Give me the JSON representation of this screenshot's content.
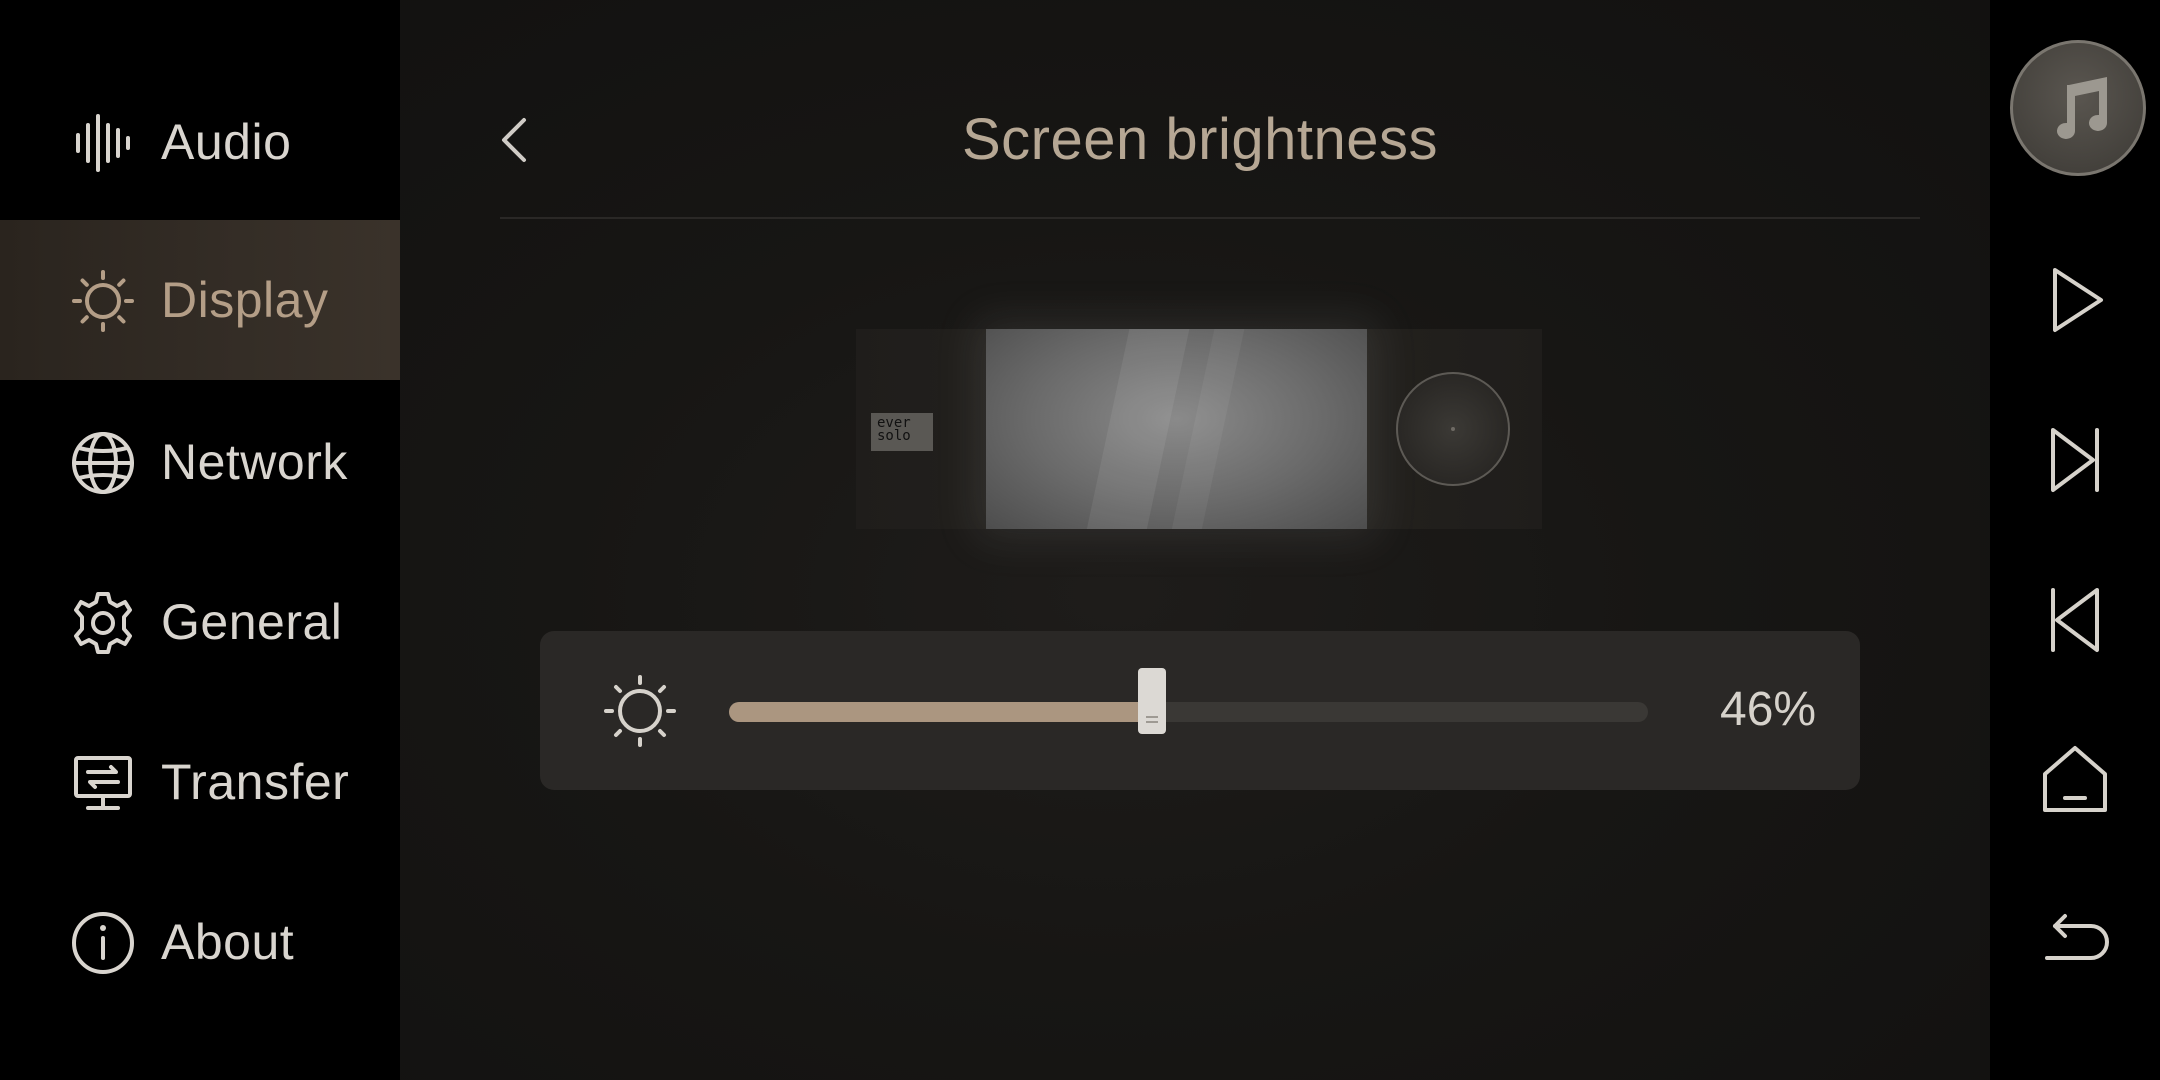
{
  "sidebar": {
    "items": [
      {
        "label": "Audio",
        "icon": "waveform-icon",
        "active": false
      },
      {
        "label": "Display",
        "icon": "brightness-icon",
        "active": true
      },
      {
        "label": "Network",
        "icon": "globe-icon",
        "active": false
      },
      {
        "label": "General",
        "icon": "gear-icon",
        "active": false
      },
      {
        "label": "Transfer",
        "icon": "transfer-icon",
        "active": false
      },
      {
        "label": "About",
        "icon": "info-icon",
        "active": false
      }
    ]
  },
  "header": {
    "title": "Screen brightness",
    "back_icon": "chevron-left-icon"
  },
  "preview": {
    "logo_text_1": "ever",
    "logo_text_2": "solo"
  },
  "brightness": {
    "value": 46,
    "value_label": "46%",
    "icon": "sun-icon"
  },
  "media_bar": {
    "album_icon": "music-note-icon",
    "buttons": [
      "play-icon",
      "skip-next-icon",
      "skip-previous-icon",
      "home-icon",
      "return-icon"
    ]
  },
  "colors": {
    "accent": "#b49e87",
    "slider_fill": "#ab9680",
    "text": "#d9d5cf"
  }
}
